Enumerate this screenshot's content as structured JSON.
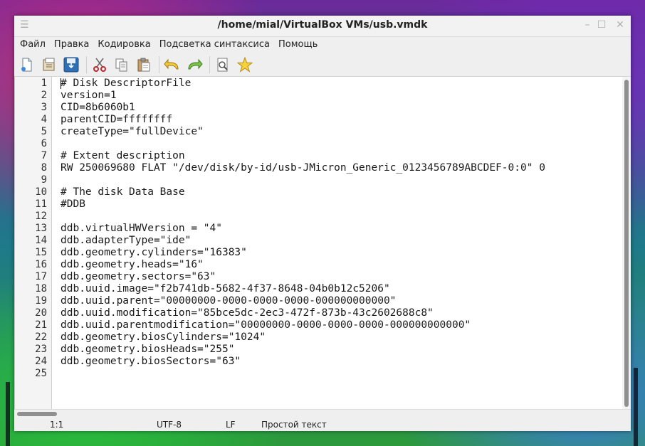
{
  "window": {
    "title": "/home/mial/VirtualBox VMs/usb.vmdk"
  },
  "menubar": {
    "items": [
      "Файл",
      "Правка",
      "Кодировка",
      "Подсветка синтаксиса",
      "Помощь"
    ]
  },
  "toolbar": {
    "icons": [
      "new-document-icon",
      "open-folder-icon",
      "save-icon",
      "cut-icon",
      "copy-icon",
      "paste-icon",
      "undo-icon",
      "redo-icon",
      "find-icon",
      "favorite-star-icon"
    ]
  },
  "editor": {
    "line_numbers": [
      "1",
      "2",
      "3",
      "4",
      "5",
      "6",
      "7",
      "8",
      "9",
      "10",
      "11",
      "12",
      "13",
      "14",
      "15",
      "16",
      "17",
      "18",
      "19",
      "20",
      "21",
      "22",
      "23",
      "24",
      "25"
    ],
    "lines": [
      "# Disk DescriptorFile",
      "version=1",
      "CID=8b6060b1",
      "parentCID=ffffffff",
      "createType=\"fullDevice\"",
      "",
      "# Extent description",
      "RW 250069680 FLAT \"/dev/disk/by-id/usb-JMicron_Generic_0123456789ABCDEF-0:0\" 0",
      "",
      "# The disk Data Base",
      "#DDB",
      "",
      "ddb.virtualHWVersion = \"4\"",
      "ddb.adapterType=\"ide\"",
      "ddb.geometry.cylinders=\"16383\"",
      "ddb.geometry.heads=\"16\"",
      "ddb.geometry.sectors=\"63\"",
      "ddb.uuid.image=\"f2b741db-5682-4f37-8648-04b0b12c5206\"",
      "ddb.uuid.parent=\"00000000-0000-0000-0000-000000000000\"",
      "ddb.uuid.modification=\"85bce5dc-2ec3-472f-873b-43c2602688c8\"",
      "ddb.uuid.parentmodification=\"00000000-0000-0000-0000-000000000000\"",
      "ddb.geometry.biosCylinders=\"1024\"",
      "ddb.geometry.biosHeads=\"255\"",
      "ddb.geometry.biosSectors=\"63\"",
      ""
    ]
  },
  "statusbar": {
    "position": "1:1",
    "encoding": "UTF-8",
    "line_ending": "LF",
    "syntax": "Простой текст"
  }
}
